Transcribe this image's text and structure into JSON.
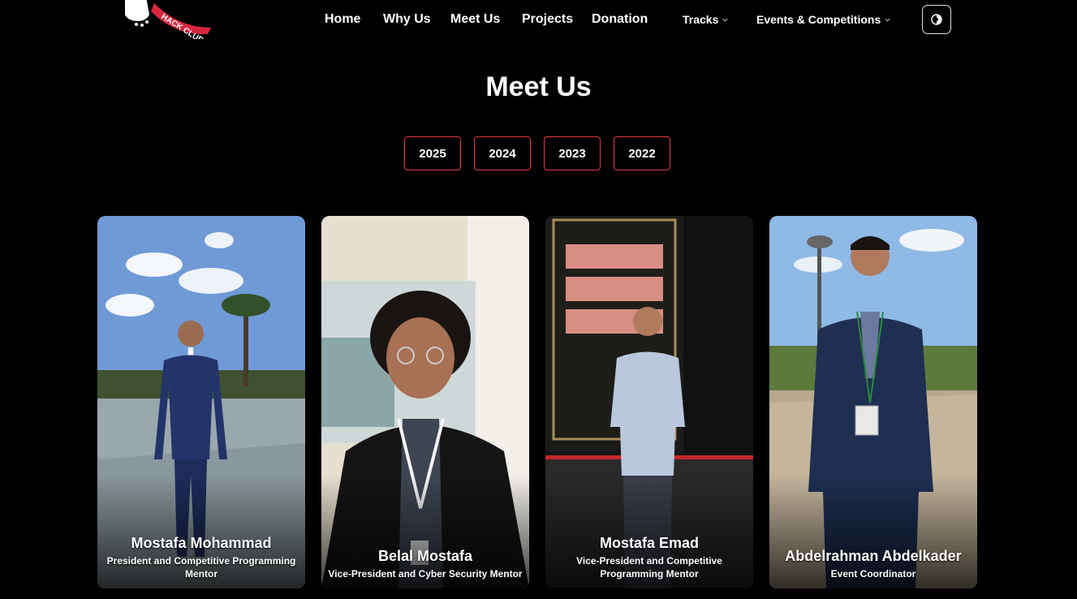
{
  "nav": {
    "logo_text": "HACK CLUB",
    "links": [
      "Home",
      "Why Us",
      "Meet Us",
      "Projects",
      "Donation"
    ],
    "dropdowns": [
      "Tracks",
      "Events & Competitions"
    ]
  },
  "main": {
    "title": "Meet Us",
    "years": [
      "2025",
      "2024",
      "2023",
      "2022"
    ]
  },
  "members": [
    {
      "name": "Mostafa Mohammad",
      "role": "President and Competitive Programming Mentor"
    },
    {
      "name": "Belal Mostafa",
      "role": "Vice-President and Cyber Security Mentor"
    },
    {
      "name": "Mostafa Emad",
      "role": "Vice-President and Competitive Programming Mentor"
    },
    {
      "name": "Abdelrahman Abdelkader",
      "role": "Event Coordinator"
    }
  ],
  "colors": {
    "background": "#000000",
    "accent_border": "#e23b3b",
    "logo_red": "#d7263d"
  },
  "icons": {
    "theme_toggle": "theme-toggle-icon",
    "dropdown": "chevron-down-icon"
  }
}
